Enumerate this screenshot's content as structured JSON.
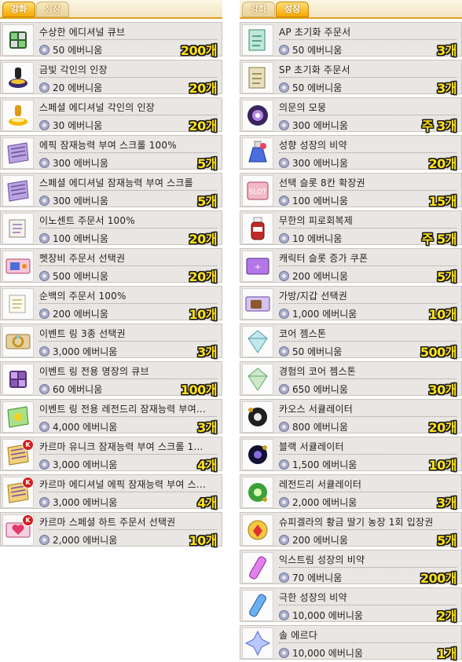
{
  "colors": {
    "tab_active": "#f5a800",
    "qty_text": "#ffe21a",
    "row_bg": "#e9e6e3"
  },
  "left": {
    "tabs": [
      {
        "label": "강화",
        "active": true
      },
      {
        "label": "성장",
        "active": false
      }
    ],
    "items": [
      {
        "name": "수상한 에디셔널 큐브",
        "price": "50 에버니움",
        "qty": "200개",
        "icon": "cube-icon",
        "karma": false
      },
      {
        "name": "금빛 각인의 인장",
        "price": "20 에버니움",
        "qty": "20개",
        "icon": "gold-stamp-icon",
        "karma": false
      },
      {
        "name": "스페셜 에디셔널 각인의 인장",
        "price": "30 에버니움",
        "qty": "20개",
        "icon": "special-stamp-icon",
        "karma": false
      },
      {
        "name": "에픽 잠재능력 부여 스크롤 100%",
        "price": "300 에버니움",
        "qty": "5개",
        "icon": "scroll-icon",
        "karma": false
      },
      {
        "name": "스페셜 에디셔널 잠재능력 부여 스크롤",
        "price": "300 에버니움",
        "qty": "5개",
        "icon": "scroll-icon",
        "karma": false
      },
      {
        "name": "이노센트 주문서 100%",
        "price": "100 에버니움",
        "qty": "20개",
        "icon": "innocent-scroll-icon",
        "karma": false
      },
      {
        "name": "펫장비 주문서 선택권",
        "price": "500 에버니움",
        "qty": "20개",
        "icon": "pet-scroll-ticket-icon",
        "karma": false
      },
      {
        "name": "순백의 주문서 100%",
        "price": "200 에버니움",
        "qty": "10개",
        "icon": "white-scroll-icon",
        "karma": false
      },
      {
        "name": "이벤트 링 3종 선택권",
        "price": "3,000 에버니움",
        "qty": "3개",
        "icon": "ring-ticket-icon",
        "karma": false
      },
      {
        "name": "이벤트 링 전용 명장의 큐브",
        "price": "60 에버니움",
        "qty": "100개",
        "icon": "purple-cube-icon",
        "karma": false
      },
      {
        "name": "이벤트 링 전용 레전드리 잠재능력 부여...",
        "price": "4,000 에버니움",
        "qty": "3개",
        "icon": "legendary-scroll-icon",
        "karma": false
      },
      {
        "name": "카르마 유니크 잠재능력 부여 스크롤 1...",
        "price": "3,000 에버니움",
        "qty": "4개",
        "icon": "karma-scroll-icon",
        "karma": true
      },
      {
        "name": "카르마 에디셔널 에픽 잠재능력 부여 스...",
        "price": "3,000 에버니움",
        "qty": "4개",
        "icon": "karma-scroll-icon",
        "karma": true
      },
      {
        "name": "카르마 스페셜 하트 주문서 선택권",
        "price": "2,000 에버니움",
        "qty": "10개",
        "icon": "heart-scroll-ticket-icon",
        "karma": true
      }
    ]
  },
  "right": {
    "tabs": [
      {
        "label": "강화",
        "active": false
      },
      {
        "label": "성장",
        "active": true
      }
    ],
    "items": [
      {
        "name": "AP 초기화 주문서",
        "price": "50 에버니움",
        "qty": "3개",
        "icon": "ap-reset-scroll-icon",
        "karma": false
      },
      {
        "name": "SP 초기화 주문서",
        "price": "50 에버니움",
        "qty": "3개",
        "icon": "sp-reset-scroll-icon",
        "karma": false
      },
      {
        "name": "의문의 모뭉",
        "price": "300 에버니움",
        "qty": "주 3개",
        "icon": "mystery-orb-icon",
        "karma": false
      },
      {
        "name": "성향 성장의 비약",
        "price": "300 에버니움",
        "qty": "20개",
        "icon": "potion-icon",
        "karma": false
      },
      {
        "name": "선택 슬롯 8칸 확장권",
        "price": "100 에버니움",
        "qty": "15개",
        "icon": "slot-expand-icon",
        "karma": false
      },
      {
        "name": "무한의 피로회복제",
        "price": "10 에버니움",
        "qty": "주 5개",
        "icon": "fatigue-bottle-icon",
        "karma": false
      },
      {
        "name": "캐릭터 슬롯 증가 쿠폰",
        "price": "200 에버니움",
        "qty": "5개",
        "icon": "slot-coupon-icon",
        "karma": false
      },
      {
        "name": "가방/지갑 선택권",
        "price": "1,000 에버니움",
        "qty": "10개",
        "icon": "bag-ticket-icon",
        "karma": false
      },
      {
        "name": "코어 젬스톤",
        "price": "50 에버니움",
        "qty": "500개",
        "icon": "core-gem-icon",
        "karma": false
      },
      {
        "name": "경험의 코어 젬스톤",
        "price": "650 에버니움",
        "qty": "30개",
        "icon": "exp-core-gem-icon",
        "karma": false
      },
      {
        "name": "카오스 서큘레이터",
        "price": "800 에버니움",
        "qty": "20개",
        "icon": "chaos-circulator-icon",
        "karma": false
      },
      {
        "name": "블랙 서큘레이터",
        "price": "1,500 에버니움",
        "qty": "10개",
        "icon": "black-circulator-icon",
        "karma": false
      },
      {
        "name": "레전드리 서큘레이터",
        "price": "2,000 에버니움",
        "qty": "3개",
        "icon": "legendary-circulator-icon",
        "karma": false
      },
      {
        "name": "슈피겔라의 황금 딸기 농장 1회 입장권",
        "price": "200 에버니움",
        "qty": "5개",
        "icon": "strawberry-farm-ticket-icon",
        "karma": false
      },
      {
        "name": "익스트림 성장의 비약",
        "price": "70 에버니움",
        "qty": "200개",
        "icon": "extreme-potion-icon",
        "karma": false
      },
      {
        "name": "극한 성장의 비약",
        "price": "10,000 에버니움",
        "qty": "2개",
        "icon": "ultimate-potion-icon",
        "karma": false
      },
      {
        "name": "솔 에르다",
        "price": "10,000 에버니움",
        "qty": "1개",
        "icon": "sol-erda-icon",
        "karma": false
      }
    ]
  }
}
